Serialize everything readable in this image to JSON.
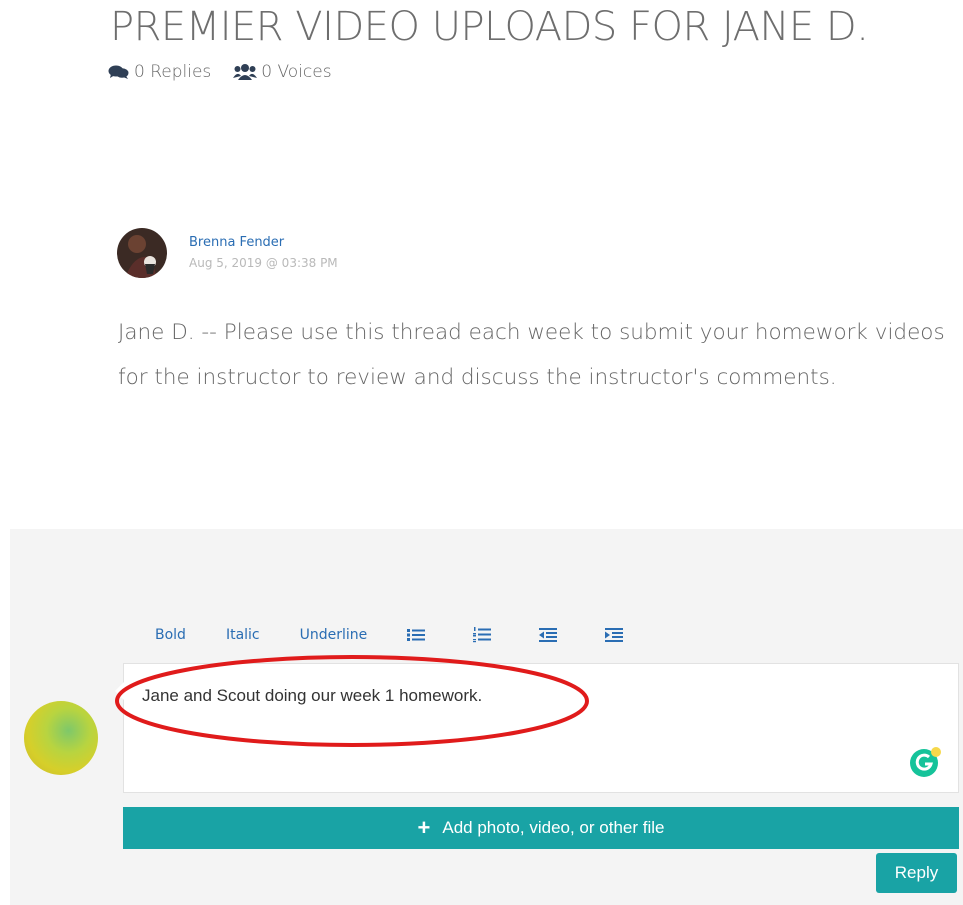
{
  "topic": {
    "title": "PREMIER VIDEO UPLOADS FOR JANE D.",
    "replies_label": "0 Replies",
    "voices_label": "0 Voices"
  },
  "post": {
    "author": "Brenna Fender",
    "date": "Aug 5, 2019 @ 03:38 PM",
    "body": "Jane D. -- Please use this thread each week to submit your homework videos for the instructor to review and discuss the instructor's comments."
  },
  "editor": {
    "toolbar": {
      "bold": "Bold",
      "italic": "Italic",
      "underline": "Underline"
    },
    "reply_text": "Jane and Scout doing our week 1 homework.",
    "add_file_label": "Add photo, video, or other file",
    "reply_button": "Reply"
  },
  "icons": {
    "replies": "comments-icon",
    "voices": "users-icon",
    "bulleted_list": "list-ul-icon",
    "numbered_list": "list-ol-icon",
    "outdent": "outdent-icon",
    "indent": "indent-icon",
    "grammarly": "grammarly-icon",
    "add": "plus-icon"
  },
  "colors": {
    "accent": "#19a3a5",
    "link": "#2a6db3",
    "annotation": "#e01b1b"
  }
}
